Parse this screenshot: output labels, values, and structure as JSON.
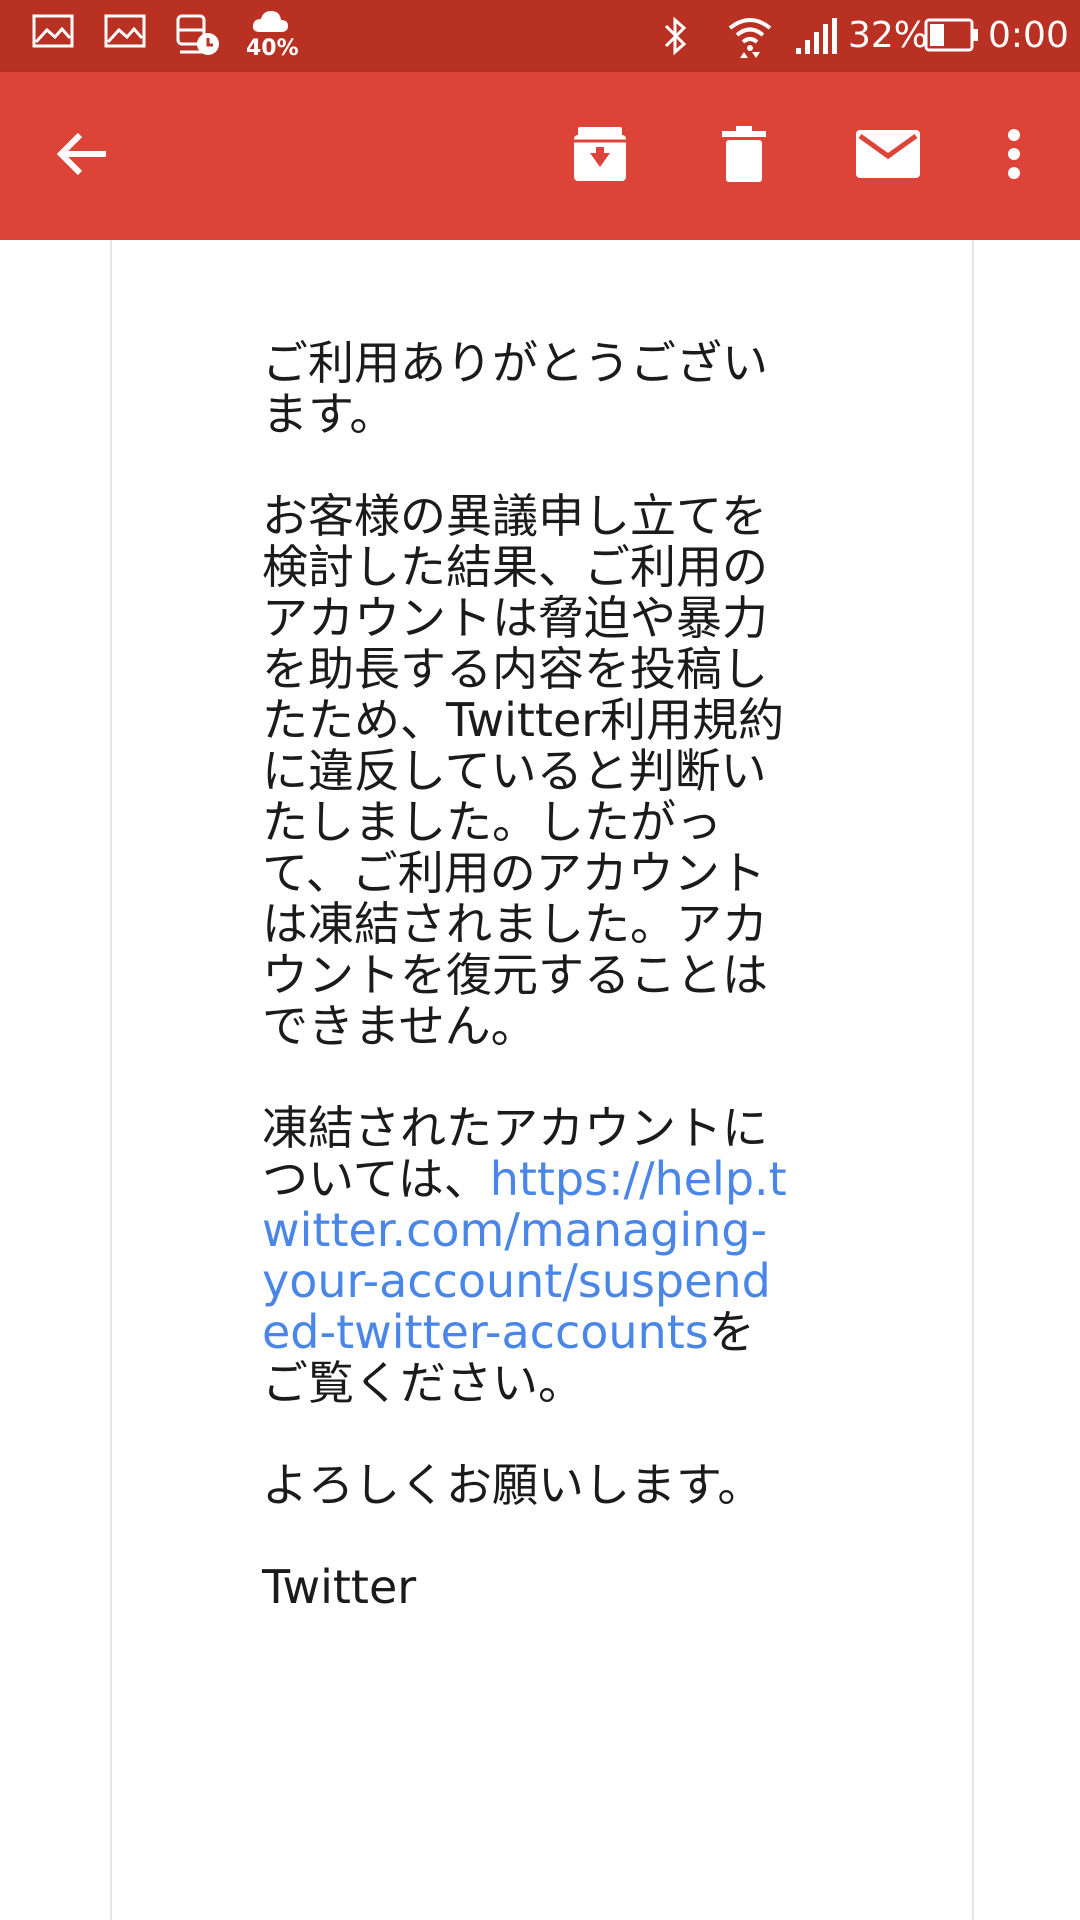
{
  "status_bar": {
    "notification_icons": [
      "image-icon",
      "image-icon",
      "train-clock-icon",
      "rain-cloud-icon"
    ],
    "weather_percent": "40%",
    "battery_percent": "32%",
    "time": "0:00",
    "system_icons": [
      "bluetooth-icon",
      "wifi-icon",
      "signal-icon",
      "battery-icon"
    ]
  },
  "toolbar": {
    "back": "arrow-back-icon",
    "actions": [
      "archive-icon",
      "delete-icon",
      "mark-unread-icon",
      "more-vert-icon"
    ]
  },
  "email": {
    "greeting": "ご利用ありがとうございます。",
    "body_paragraph": "お客様の異議申し立てを検討した結果、ご利用のアカウントは脅迫や暴力を助長する内容を投稿したため、Twitter利用規約に違反していると判断いたしました。したがって、ご利用のアカウントは凍結されました。アカウントを復元することはできません。",
    "info_prefix": "凍結されたアカウントについては、",
    "info_link": "https://help.twitter.com/managing-your-account/suspended-twitter-accounts",
    "info_suffix": "をご覧ください。",
    "closing": "よろしくお願いします。",
    "signature": "Twitter"
  },
  "colors": {
    "status_bar": "#b93123",
    "toolbar": "#db4437",
    "link": "#4a86e8",
    "text": "#1b1b1b"
  }
}
